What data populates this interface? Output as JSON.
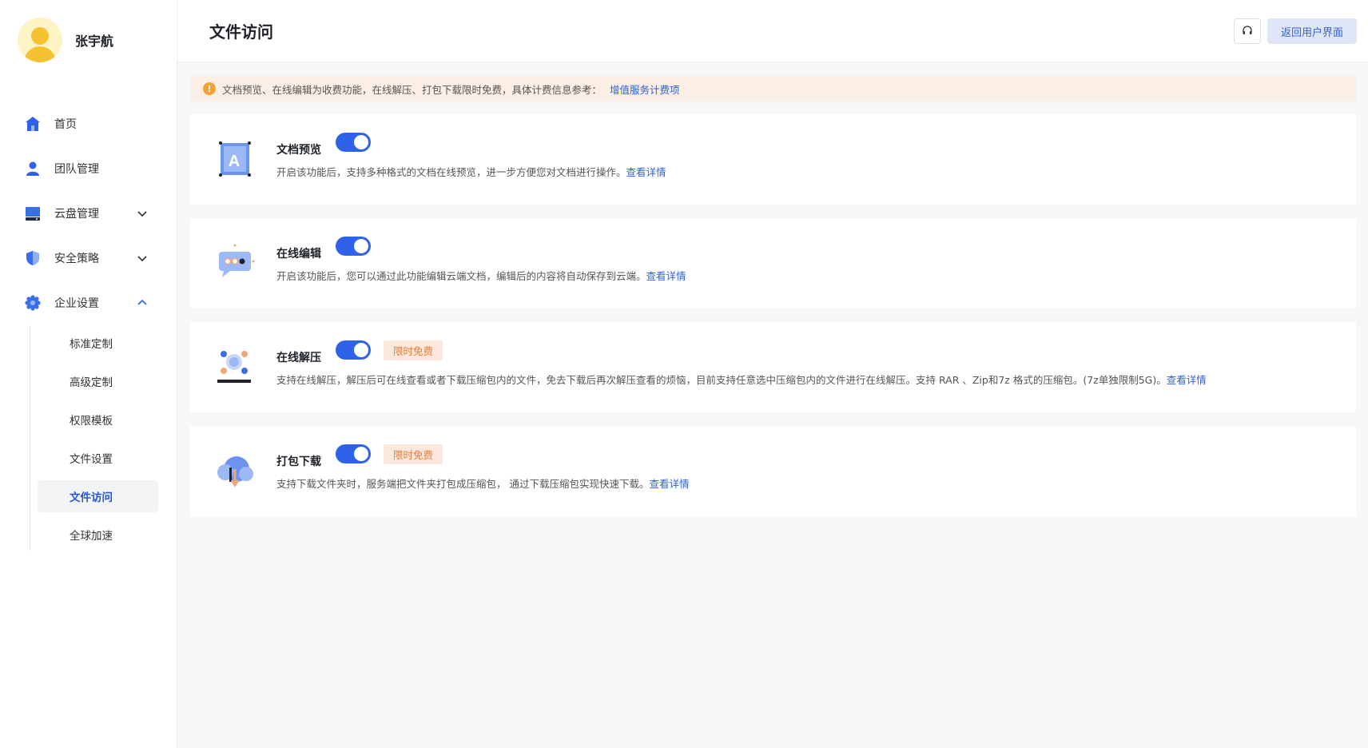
{
  "user": {
    "name": "张宇航"
  },
  "nav": {
    "home": "首页",
    "team": "团队管理",
    "cloud": "云盘管理",
    "security": "安全策略",
    "enterprise": "企业设置",
    "sub": [
      "标准定制",
      "高级定制",
      "权限模板",
      "文件设置",
      "文件访问",
      "全球加速"
    ]
  },
  "header": {
    "title": "文件访问",
    "back_label": "返回用户界面"
  },
  "notice": {
    "text": "文档预览、在线编辑为收费功能，在线解压、打包下载限时免费，具体计费信息参考：",
    "link": "增值服务计费项"
  },
  "features": [
    {
      "title": "文档预览",
      "enabled": true,
      "desc": "开启该功能后，支持多种格式的文档在线预览，进一步方便您对文档进行操作。",
      "link": "查看详情"
    },
    {
      "title": "在线编辑",
      "enabled": true,
      "desc": "开启该功能后，您可以通过此功能编辑云端文档，编辑后的内容将自动保存到云端。",
      "link": "查看详情"
    },
    {
      "title": "在线解压",
      "enabled": true,
      "badge": "限时免费",
      "desc": "支持在线解压，解压后可在线查看或者下载压缩包内的文件，免去下载后再次解压查看的烦恼，目前支持任意选中压缩包内的文件进行在线解压。支持 RAR 、Zip和7z 格式的压缩包。(7z单独限制5G)。",
      "link": "查看详情"
    },
    {
      "title": "打包下载",
      "enabled": true,
      "badge": "限时免费",
      "desc": "支持下载文件夹时，服务端把文件夹打包成压缩包， 通过下载压缩包实现快速下载。",
      "link": "查看详情"
    }
  ],
  "colors": {
    "accent": "#2f62e8",
    "badge_bg": "#fbe8dc",
    "badge_text": "#e77e3d",
    "notice_bg": "#fbeee4"
  }
}
